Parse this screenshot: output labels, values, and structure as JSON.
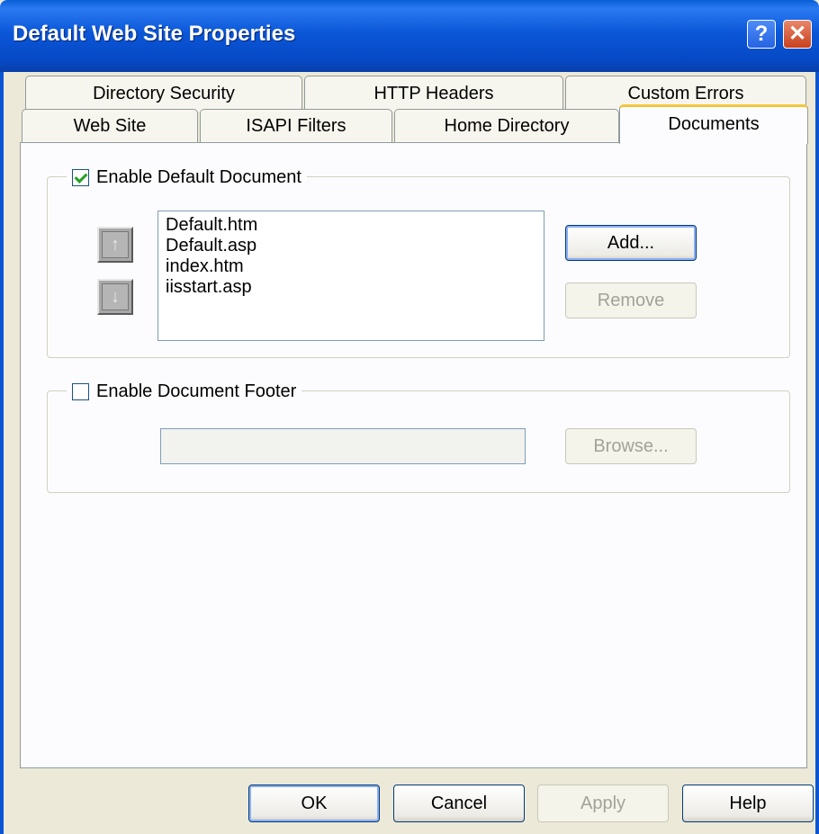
{
  "window": {
    "title": "Default Web Site Properties",
    "help_glyph": "?",
    "close_glyph": "✕"
  },
  "tabs": {
    "row_back": [
      "Directory Security",
      "HTTP Headers",
      "Custom Errors"
    ],
    "row_front": [
      "Web Site",
      "ISAPI Filters",
      "Home Directory",
      "Documents"
    ],
    "active": "Documents"
  },
  "default_document": {
    "label": "Enable Default Document",
    "checked": true,
    "documents": [
      "Default.htm",
      "Default.asp",
      "index.htm",
      "iisstart.asp"
    ],
    "move_up_glyph": "↑",
    "move_down_glyph": "↓",
    "add_label": "Add...",
    "remove_label": "Remove"
  },
  "document_footer": {
    "label": "Enable Document Footer",
    "checked": false,
    "path_value": "",
    "browse_label": "Browse..."
  },
  "buttons": {
    "ok": "OK",
    "cancel": "Cancel",
    "apply": "Apply",
    "help": "Help"
  },
  "colors": {
    "titlebar": "#0a5fd6",
    "dialog_bg": "#ece9d8",
    "active_tab_highlight": "#f2c53a"
  }
}
